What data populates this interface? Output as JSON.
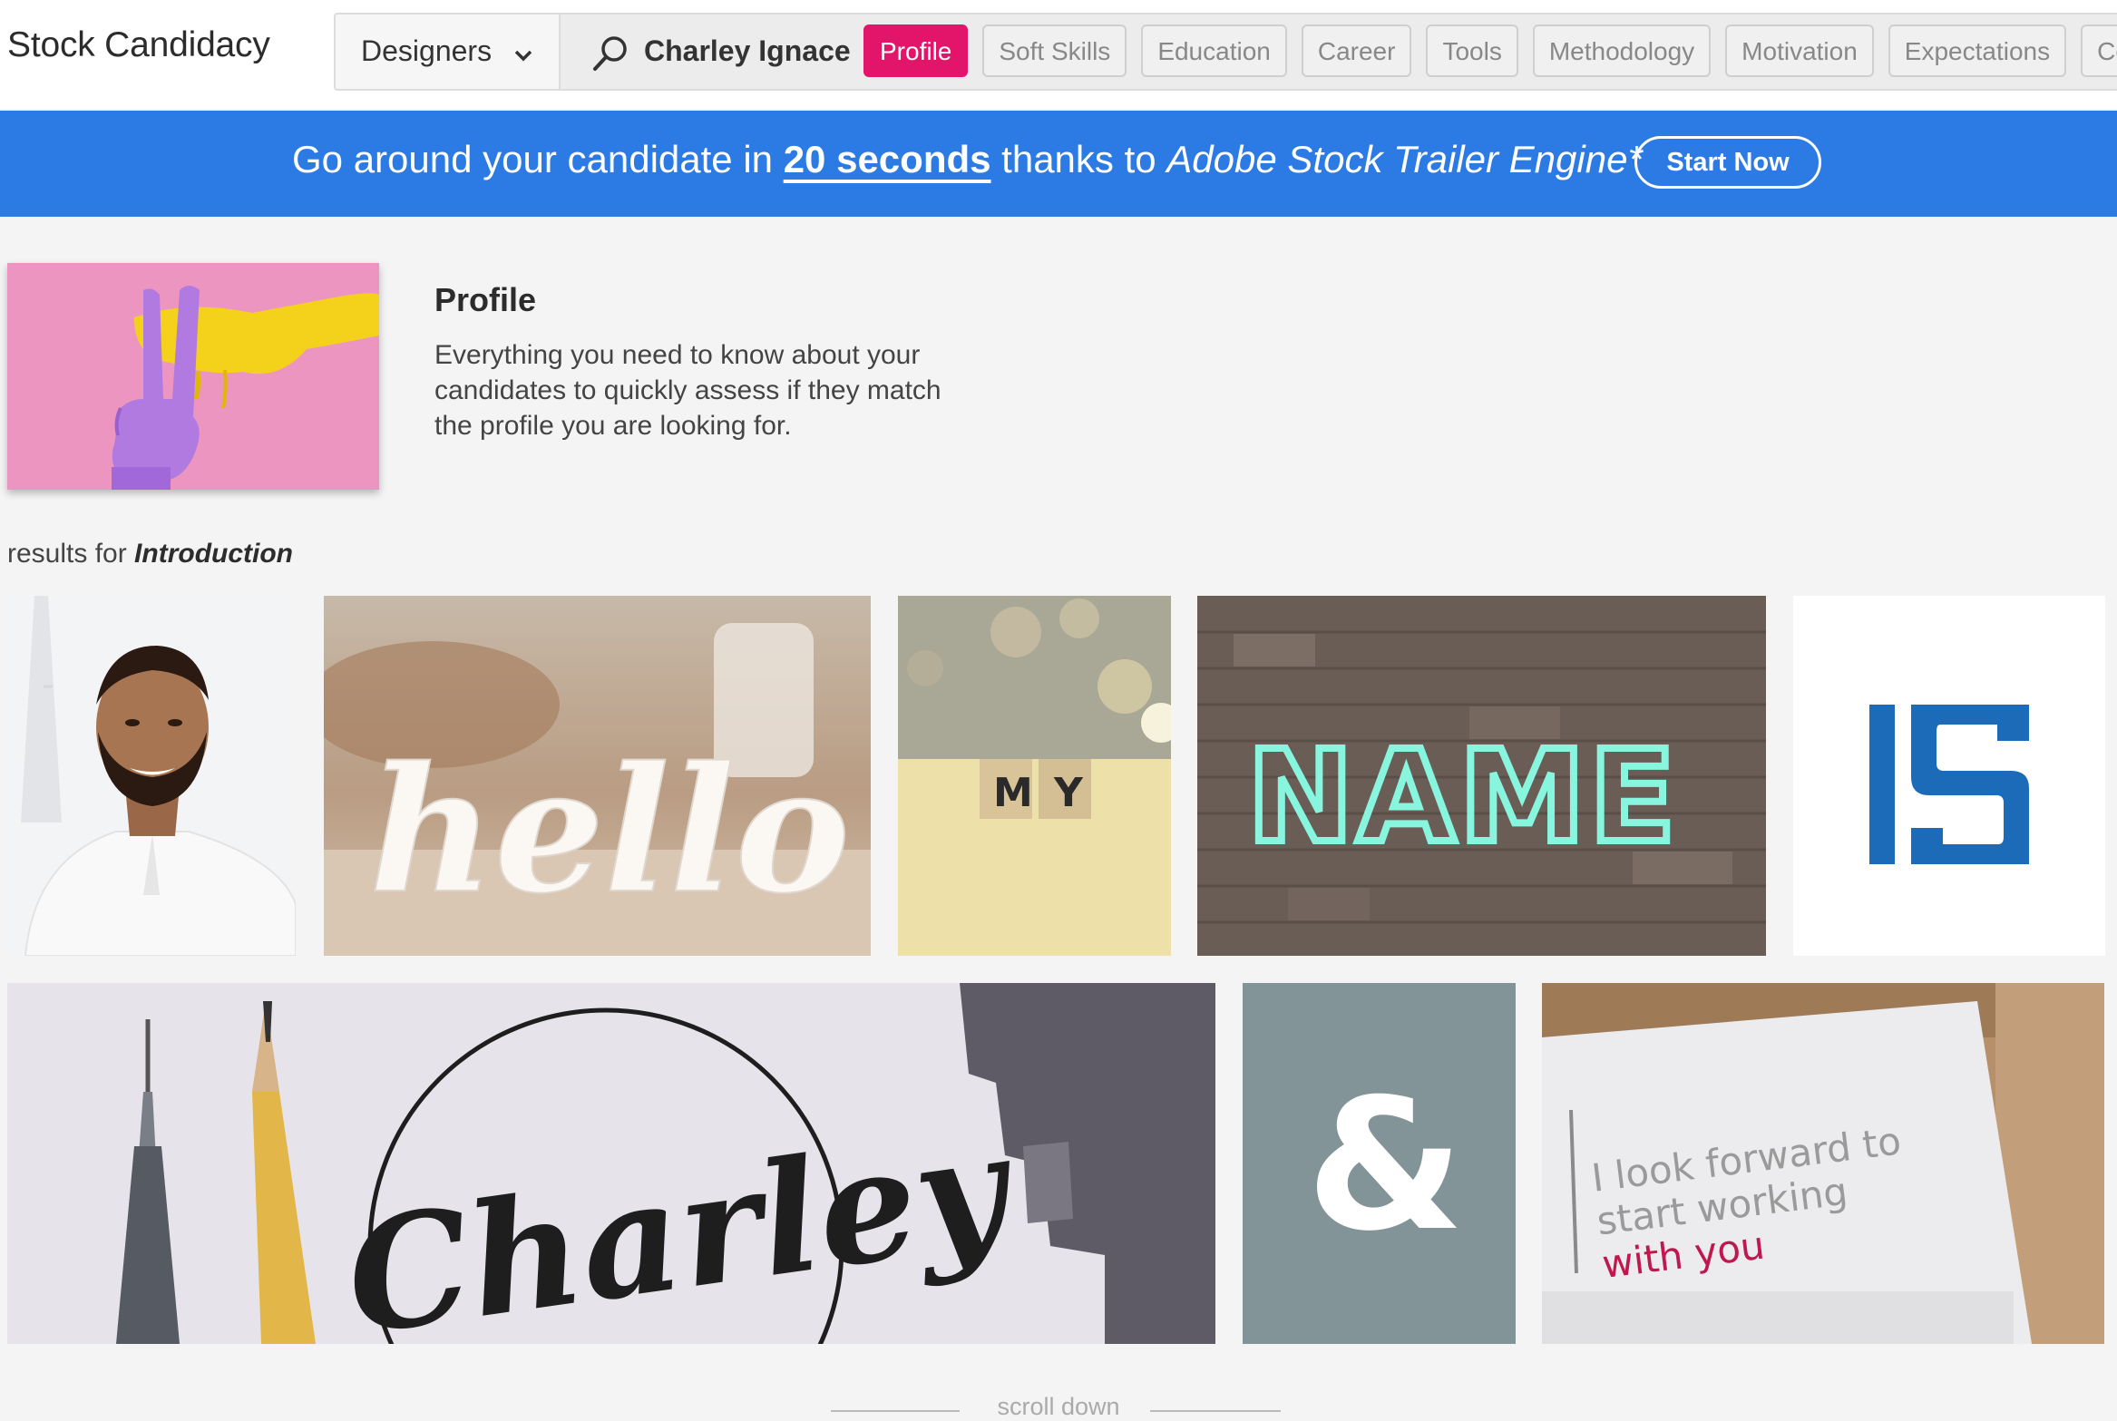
{
  "header": {
    "brand": "Stock Candidacy",
    "department": "Designers",
    "query": "Charley Ignace",
    "tabs": [
      {
        "label": "Profile",
        "active": true
      },
      {
        "label": "Soft Skills",
        "active": false
      },
      {
        "label": "Education",
        "active": false
      },
      {
        "label": "Career",
        "active": false
      },
      {
        "label": "Tools",
        "active": false
      },
      {
        "label": "Methodology",
        "active": false
      },
      {
        "label": "Motivation",
        "active": false
      },
      {
        "label": "Expectations",
        "active": false
      },
      {
        "label": "Cont",
        "active": false
      }
    ]
  },
  "banner": {
    "prefix": "Go around your candidate in ",
    "highlight": "20 seconds",
    "middle": " thanks to ",
    "engine": "Adobe Stock Trailer Engine*",
    "button": "Start Now"
  },
  "intro": {
    "title": "Profile",
    "description": "Everything you need to know about your candidates to quickly assess if they match the profile you are looking for."
  },
  "results": {
    "prefix": "results for ",
    "keyword": "Introduction"
  },
  "tiles": {
    "hello": "hello",
    "my": [
      "M",
      "Y"
    ],
    "name": "NAME",
    "logo": "IS",
    "charley": "Charley",
    "amp": "&",
    "card": [
      "I look forward to",
      "start working",
      "with you"
    ]
  },
  "footer": {
    "scroll": "scroll down"
  },
  "colors": {
    "accent": "#e2156b",
    "banner": "#2c7be5",
    "logo_blue": "#1c6bb8",
    "neon": "#7fffe0"
  }
}
